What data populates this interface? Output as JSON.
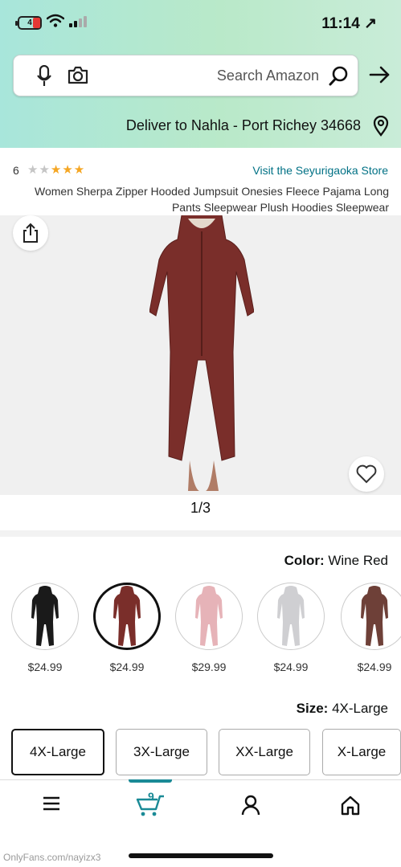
{
  "status_bar": {
    "time": "11:14 ↗",
    "battery": "4"
  },
  "search": {
    "placeholder": "Search Amazon"
  },
  "delivery": {
    "text": "Deliver to Nahla - Port Richey 34668"
  },
  "product": {
    "store_link": "Visit the Seyurigaoka Store",
    "rating_stars": 3,
    "rating_count": "6",
    "title": "Women Sherpa Zipper Hooded Jumpsuit Onesies Fleece Pajama Long Pants Sleepwear Plush Hoodies Sleepwear",
    "image_pager": "1/3",
    "image_color_hex": "#7a2e2a"
  },
  "color": {
    "label": "Color:",
    "value": "Wine Red",
    "options": [
      {
        "name": "black",
        "price": "$24.99",
        "hex": "#1a1a1a"
      },
      {
        "name": "wine-red",
        "price": "$24.99",
        "hex": "#7a2e2a",
        "selected": true
      },
      {
        "name": "pink",
        "price": "$29.99",
        "hex": "#e6b3b8"
      },
      {
        "name": "grey",
        "price": "$24.99",
        "hex": "#cfcfd2"
      },
      {
        "name": "brown",
        "price": "$24.99",
        "hex": "#6e4038"
      }
    ]
  },
  "size": {
    "label": "Size:",
    "value": "4X-Large",
    "options": [
      {
        "label": "4X-Large",
        "selected": true
      },
      {
        "label": "3X-Large"
      },
      {
        "label": "XX-Large"
      },
      {
        "label": "X-Large"
      }
    ]
  },
  "bottom_nav": {
    "cart_count": "9"
  },
  "watermark": "OnlyFans.com/nayizx3",
  "colors": {
    "accent": "#1a8a96",
    "link": "#007185",
    "star": "#f5a623"
  }
}
